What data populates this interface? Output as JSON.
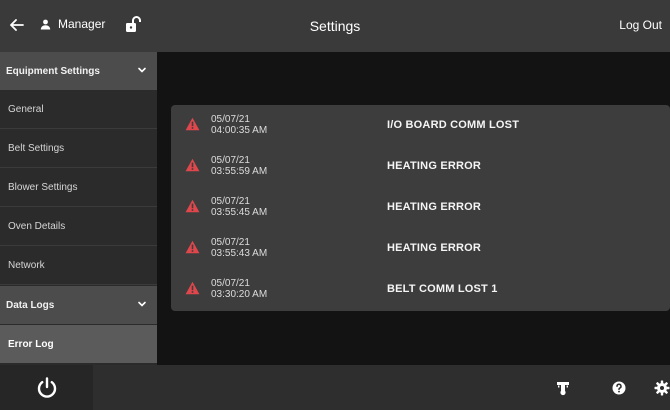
{
  "header": {
    "title": "Settings",
    "user_label": "Manager",
    "logout_label": "Log Out",
    "back_icon": "arrow-left-icon",
    "user_icon": "person-icon",
    "lock_icon": "unlocked-padlock-icon"
  },
  "sidebar": {
    "sections": [
      {
        "label": "Equipment Settings",
        "items": [
          {
            "label": "General"
          },
          {
            "label": "Belt Settings"
          },
          {
            "label": "Blower Settings"
          },
          {
            "label": "Oven Details"
          },
          {
            "label": "Network"
          }
        ]
      },
      {
        "label": "Data Logs",
        "items": [
          {
            "label": "Error Log",
            "active": true
          }
        ]
      }
    ]
  },
  "error_log": {
    "entries": [
      {
        "date": "05/07/21",
        "time": "04:00:35 AM",
        "message": "I/O BOARD COMM LOST"
      },
      {
        "date": "05/07/21",
        "time": "03:55:59 AM",
        "message": "HEATING ERROR"
      },
      {
        "date": "05/07/21",
        "time": "03:55:45 AM",
        "message": "HEATING ERROR"
      },
      {
        "date": "05/07/21",
        "time": "03:55:43 AM",
        "message": "HEATING ERROR"
      },
      {
        "date": "05/07/21",
        "time": "03:30:20 AM",
        "message": "BELT COMM LOST 1"
      }
    ]
  },
  "footer": {
    "icons": [
      "power-icon",
      "thermometer-icon",
      "help-icon",
      "gear-icon"
    ]
  },
  "colors": {
    "warning": "#e0474c",
    "header_bg": "#3a3a3a",
    "sidebar_section_bg": "#4c4c4c",
    "sidebar_active_bg": "#5b5b5b",
    "panel_bg": "#3d3d3d"
  }
}
